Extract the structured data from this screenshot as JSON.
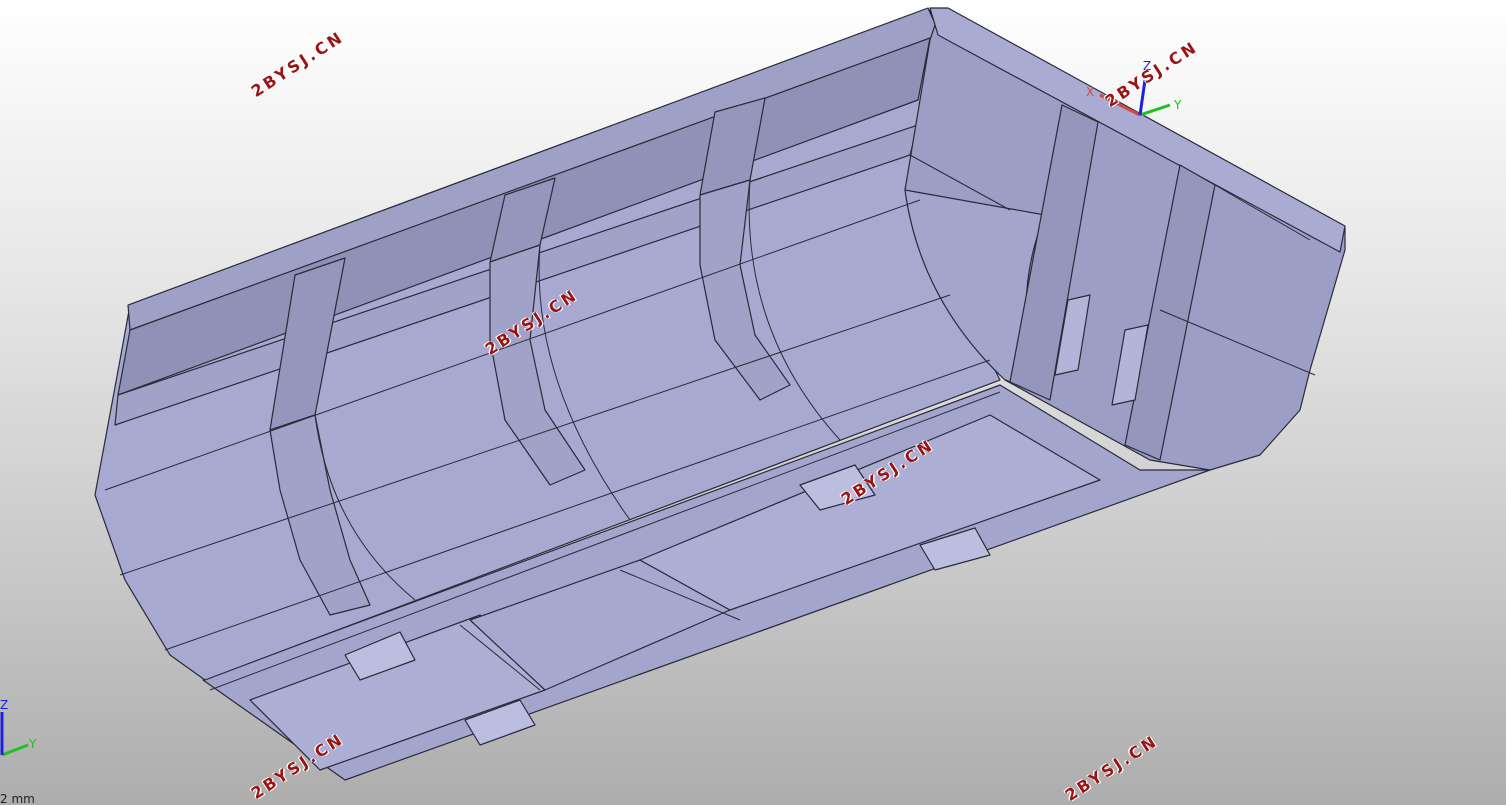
{
  "viewer": {
    "watermarks": [
      "2BYSJ.CN",
      "2BYSJ.CN",
      "2BYSJ.CN",
      "2BYSJ.CN",
      "2BYSJ.CN",
      "2BYSJ.CN"
    ],
    "scale_label": "2 mm",
    "colors": {
      "model_fill_light": "#aaaccf",
      "model_fill_mid": "#9c9ec4",
      "model_fill_dark": "#8f91b6",
      "edge": "#2a2a3a",
      "watermark": "#9a1414",
      "axis_x": "#d03030",
      "axis_y": "#20c020",
      "axis_z": "#2020e0"
    }
  },
  "triad_top": {
    "x": "X",
    "y": "Y",
    "z": "Z"
  },
  "triad_corner": {
    "y": "Y",
    "z": "Z"
  }
}
